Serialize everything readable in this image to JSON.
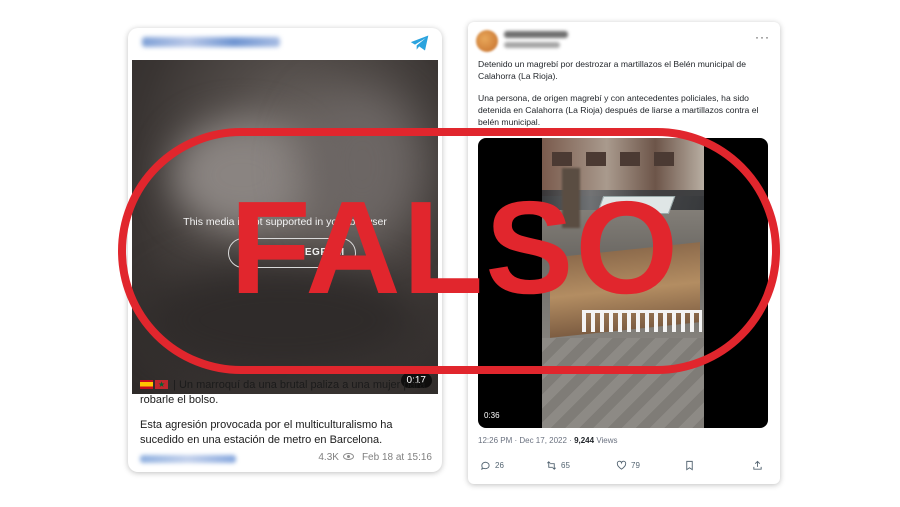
{
  "left_post": {
    "media_message": "This media is not supported in your browser",
    "view_button_label": "VIEW IN TELEGRAM",
    "duration": "0:17",
    "text_line1": "| Un marroquí da una brutal paliza a una mujer para robarle el bolso.",
    "text_line2": "Esta agresión provocada por el  multiculturalismo ha sucedido en una estación de metro en Barcelona.",
    "views": "4.3K",
    "date": "Feb 18 at 15:16",
    "icon": "telegram-icon"
  },
  "right_post": {
    "paragraph1": "Detenido un magrebí por destrozar a martillazos el Belén municipal de Calahorra (La Rioja).",
    "paragraph2": "Una persona, de origen magrebí y con antecedentes policiales, ha sido detenida en Calahorra (La Rioja) después de liarse a martillazos contra el belén municipal.",
    "video_duration": "0:36",
    "timestamp": "12:26 PM · Dec 17, 2022 · ",
    "views_count": "9,244",
    "views_label": " Views",
    "replies": "26",
    "reposts": "65",
    "likes": "79"
  },
  "stamp": {
    "text": "FALSO",
    "color": "#e1262d"
  }
}
